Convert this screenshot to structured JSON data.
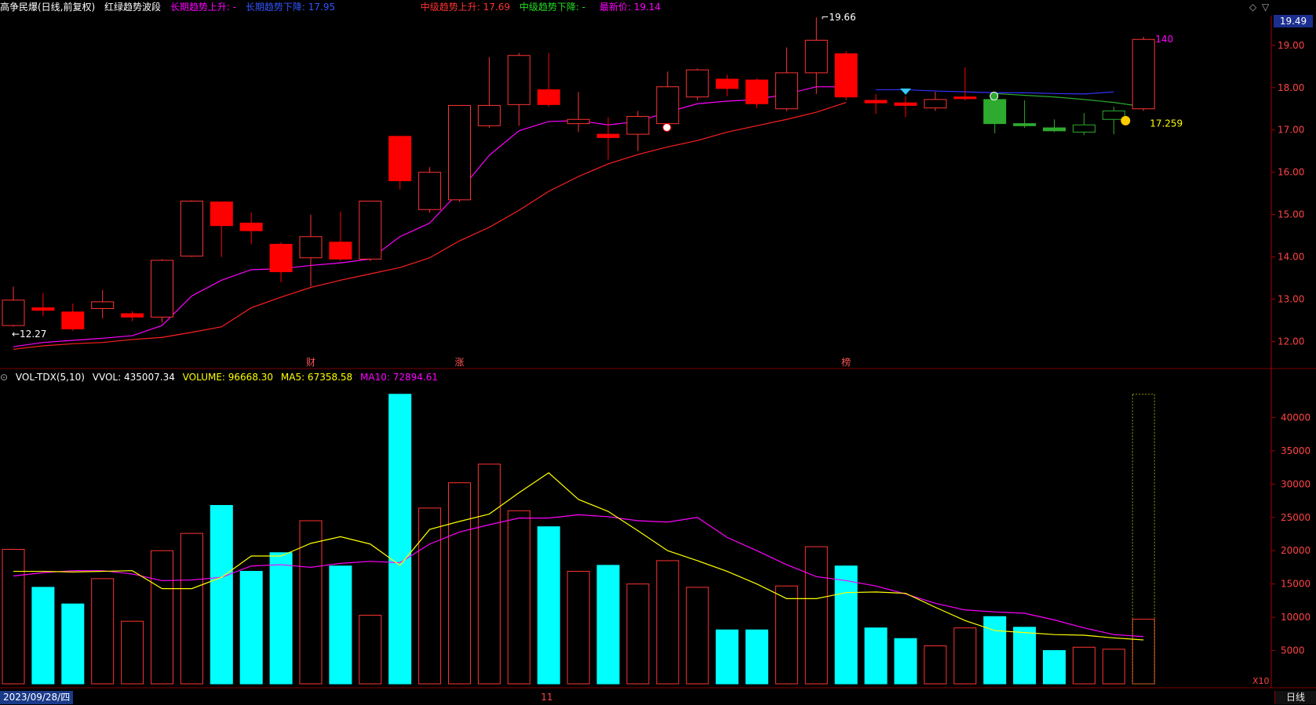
{
  "header": {
    "title": "高争民爆(日线,前复权)",
    "indicator": "红绿趋势波段",
    "long_up_label": "长期趋势上升: -",
    "long_down_label": "长期趋势下降: 17.95",
    "long_down_value": ": 17.95",
    "mid_up_label": "中级趋势上升: 17.69",
    "mid_down_label": "中级趋势下降: -",
    "latest_label": "最新价: 19.14"
  },
  "volume_header": {
    "name": "VOL-TDX(5,10)",
    "vvol": "VVOL: 435007.34",
    "volume": "VOLUME: 96668.30",
    "ma5": "MA5: 67358.58",
    "ma10": "MA10: 72894.61"
  },
  "footer": {
    "date": "2023/09/28/四",
    "month_mark": "11",
    "period": "日线",
    "x10": "X10"
  },
  "price_tag": "19.49",
  "colors": {
    "up": "#ff3333",
    "down_price": "#ff0000",
    "green": "#2eaa2e",
    "cyan": "#00ffff",
    "magenta": "#ff00ff",
    "yellow": "#ffff00",
    "blue": "#3333ff",
    "axis": "#aa0000"
  },
  "chart_data": [
    {
      "type": "candlestick",
      "title": "高争民爆(日线,前复权)",
      "ylim": [
        11.4,
        19.7
      ],
      "y_ticks": [
        "12.00",
        "13.00",
        "14.00",
        "15.00",
        "16.00",
        "17.00",
        "18.00",
        "19.00"
      ],
      "candles": [
        {
          "o": 12.38,
          "h": 13.3,
          "l": 12.35,
          "c": 12.98,
          "s": "up_hollow"
        },
        {
          "o": 12.8,
          "h": 13.15,
          "l": 12.6,
          "c": 12.74,
          "s": "down_solid"
        },
        {
          "o": 12.7,
          "h": 12.9,
          "l": 12.25,
          "c": 12.3,
          "s": "down_solid"
        },
        {
          "o": 12.78,
          "h": 13.22,
          "l": 12.55,
          "c": 12.94,
          "s": "up_hollow"
        },
        {
          "o": 12.66,
          "h": 12.72,
          "l": 12.48,
          "c": 12.58,
          "s": "down_solid"
        },
        {
          "o": 12.58,
          "h": 13.95,
          "l": 12.45,
          "c": 13.92,
          "s": "up_hollow"
        },
        {
          "o": 14.02,
          "h": 15.34,
          "l": 14.0,
          "c": 15.32,
          "s": "up_hollow"
        },
        {
          "o": 15.3,
          "h": 15.3,
          "l": 14.0,
          "c": 14.74,
          "s": "down_solid"
        },
        {
          "o": 14.8,
          "h": 15.05,
          "l": 14.3,
          "c": 14.62,
          "s": "down_solid"
        },
        {
          "o": 14.3,
          "h": 14.35,
          "l": 13.4,
          "c": 13.65,
          "s": "down_solid"
        },
        {
          "o": 13.98,
          "h": 15.0,
          "l": 13.3,
          "c": 14.48,
          "s": "up_hollow"
        },
        {
          "o": 14.35,
          "h": 15.07,
          "l": 13.9,
          "c": 13.95,
          "s": "down_solid"
        },
        {
          "o": 13.95,
          "h": 15.32,
          "l": 13.9,
          "c": 15.32,
          "s": "up_hollow"
        },
        {
          "o": 16.85,
          "h": 16.85,
          "l": 15.6,
          "c": 15.8,
          "s": "down_solid"
        },
        {
          "o": 15.12,
          "h": 16.12,
          "l": 15.05,
          "c": 16.0,
          "s": "up_hollow"
        },
        {
          "o": 15.35,
          "h": 17.58,
          "l": 15.3,
          "c": 17.58,
          "s": "up_hollow"
        },
        {
          "o": 17.1,
          "h": 18.72,
          "l": 17.05,
          "c": 17.58,
          "s": "up_hollow"
        },
        {
          "o": 17.6,
          "h": 18.82,
          "l": 17.1,
          "c": 18.76,
          "s": "up_hollow"
        },
        {
          "o": 17.95,
          "h": 18.82,
          "l": 17.55,
          "c": 17.6,
          "s": "down_solid"
        },
        {
          "o": 17.15,
          "h": 17.9,
          "l": 16.95,
          "c": 17.25,
          "s": "up_hollow"
        },
        {
          "o": 16.9,
          "h": 17.3,
          "l": 16.3,
          "c": 16.82,
          "s": "down_solid"
        },
        {
          "o": 16.9,
          "h": 17.45,
          "l": 16.5,
          "c": 17.32,
          "s": "up_hollow"
        },
        {
          "o": 17.15,
          "h": 18.38,
          "l": 17.1,
          "c": 18.02,
          "s": "up_hollow"
        },
        {
          "o": 17.78,
          "h": 18.45,
          "l": 17.7,
          "c": 18.42,
          "s": "up_hollow"
        },
        {
          "o": 18.2,
          "h": 18.3,
          "l": 17.8,
          "c": 17.98,
          "s": "down_solid"
        },
        {
          "o": 18.18,
          "h": 18.22,
          "l": 17.52,
          "c": 17.62,
          "s": "down_solid"
        },
        {
          "o": 17.5,
          "h": 18.95,
          "l": 17.45,
          "c": 18.35,
          "s": "up_hollow"
        },
        {
          "o": 18.35,
          "h": 19.66,
          "l": 17.85,
          "c": 19.12,
          "s": "up_hollow"
        },
        {
          "o": 18.8,
          "h": 18.86,
          "l": 17.7,
          "c": 17.78,
          "s": "down_solid"
        },
        {
          "o": 17.7,
          "h": 17.85,
          "l": 17.38,
          "c": 17.64,
          "s": "down_solid"
        },
        {
          "o": 17.64,
          "h": 17.8,
          "l": 17.3,
          "c": 17.58,
          "s": "down_solid"
        },
        {
          "o": 17.52,
          "h": 17.9,
          "l": 17.45,
          "c": 17.72,
          "s": "up_hollow"
        },
        {
          "o": 17.78,
          "h": 18.48,
          "l": 17.7,
          "c": 17.74,
          "s": "down_solid"
        },
        {
          "o": 17.72,
          "h": 17.75,
          "l": 16.92,
          "c": 17.15,
          "s": "green_solid"
        },
        {
          "o": 17.15,
          "h": 17.7,
          "l": 17.05,
          "c": 17.1,
          "s": "green_solid"
        },
        {
          "o": 17.05,
          "h": 17.25,
          "l": 16.95,
          "c": 16.98,
          "s": "green_solid"
        },
        {
          "o": 16.95,
          "h": 17.4,
          "l": 16.88,
          "c": 17.12,
          "s": "green_hollow"
        },
        {
          "o": 17.25,
          "h": 17.55,
          "l": 16.9,
          "c": 17.45,
          "s": "green_hollow"
        },
        {
          "o": 17.5,
          "h": 19.2,
          "l": 17.45,
          "c": 19.14,
          "s": "up_hollow"
        }
      ],
      "line_magenta": [
        11.88,
        11.98,
        12.03,
        12.08,
        12.14,
        12.38,
        13.08,
        13.45,
        13.7,
        13.72,
        13.8,
        13.86,
        13.95,
        14.48,
        14.8,
        15.55,
        16.4,
        16.98,
        17.2,
        17.22,
        17.12,
        17.2,
        17.42,
        17.62,
        17.68,
        17.72,
        17.85,
        18.02,
        18.02
      ],
      "line_red": [
        11.82,
        11.9,
        11.95,
        11.98,
        12.05,
        12.1,
        12.22,
        12.35,
        12.8,
        13.05,
        13.28,
        13.45,
        13.6,
        13.75,
        13.98,
        14.38,
        14.7,
        15.1,
        15.55,
        15.9,
        16.2,
        16.42,
        16.6,
        16.75,
        16.95,
        17.1,
        17.25,
        17.42,
        17.65
      ],
      "line_green": [
        17.86,
        17.82,
        17.78,
        17.72,
        17.65,
        17.55
      ],
      "line_blue": [
        17.95,
        17.95,
        17.92,
        17.9,
        17.88,
        17.88,
        17.86,
        17.85,
        17.9
      ],
      "annotations": {
        "high": "19.66",
        "low": "12.27",
        "right_label": "17.259",
        "top_right_label": "140"
      },
      "markers": [
        "财",
        "涨",
        "榜"
      ]
    },
    {
      "type": "bar",
      "title": "VOL-TDX(5,10)",
      "ylim": [
        0,
        45000
      ],
      "y_ticks": [
        "5000",
        "10000",
        "15000",
        "20000",
        "25000",
        "30000",
        "35000",
        "40000"
      ],
      "values": [
        20200,
        14500,
        12000,
        15800,
        9400,
        20000,
        22600,
        26800,
        16900,
        19700,
        24500,
        17700,
        10300,
        43500,
        26400,
        30200,
        33000,
        26000,
        23600,
        16900,
        17800,
        15000,
        18500,
        14500,
        8100,
        8100,
        14700,
        20600,
        17700,
        8400,
        6800,
        5700,
        8400,
        10100,
        8500,
        5000,
        5500,
        5200,
        9700
      ],
      "colors": [
        "up",
        "cyan",
        "cyan",
        "up",
        "up",
        "up",
        "up",
        "cyan",
        "cyan",
        "cyan",
        "up",
        "cyan",
        "up",
        "cyan",
        "up",
        "up",
        "up",
        "up",
        "cyan",
        "up",
        "cyan",
        "up",
        "up",
        "up",
        "cyan",
        "cyan",
        "up",
        "up",
        "cyan",
        "cyan",
        "cyan",
        "up",
        "up",
        "cyan",
        "cyan",
        "cyan",
        "up",
        "up",
        "up"
      ],
      "ma5": [
        16900,
        16900,
        16800,
        16900,
        17000,
        14300,
        14300,
        16000,
        19200,
        19200,
        21100,
        22100,
        21000,
        17800,
        23200,
        24400,
        25500,
        28700,
        31700,
        27700,
        25900,
        23000,
        20000,
        18500,
        16900,
        15000,
        12800,
        12800,
        13700,
        13800,
        13600,
        11500,
        9500,
        8000,
        7700,
        7400,
        7300,
        6900,
        6600
      ],
      "ma10": [
        16200,
        16700,
        17000,
        17000,
        16500,
        15500,
        15600,
        16000,
        17700,
        17900,
        17500,
        18100,
        18400,
        18200,
        21000,
        22800,
        23900,
        24900,
        24900,
        25400,
        25100,
        24500,
        24300,
        25000,
        22000,
        20000,
        17900,
        16100,
        15500,
        14700,
        13500,
        12100,
        11100,
        10800,
        10600,
        9600,
        8400,
        7400,
        7100
      ],
      "ghost_bar": 43500
    }
  ]
}
